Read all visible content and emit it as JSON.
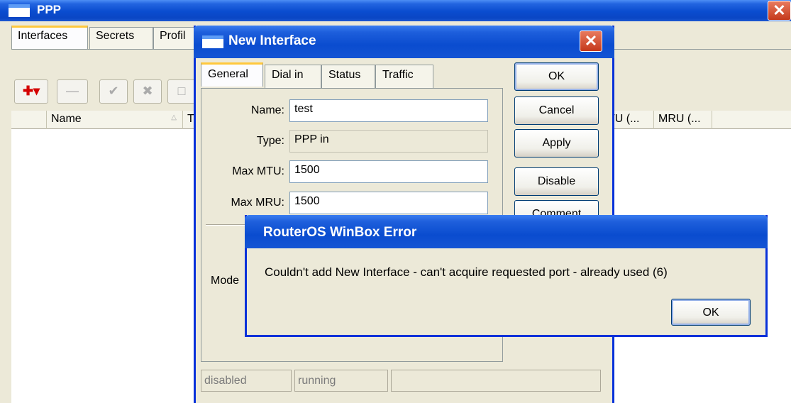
{
  "ppp_window": {
    "title": "PPP",
    "tabs": [
      "Interfaces",
      "Secrets",
      "Profil"
    ],
    "toolbar": {
      "add_symbol": "✚▾",
      "remove_symbol": "—",
      "enable_symbol": "✔",
      "disable_symbol": "✖",
      "comment_symbol": "□"
    },
    "columns": {
      "name": "Name",
      "sort_indicator": "△",
      "type_partial": "T",
      "mtu": "TU (...",
      "mru": "MRU (..."
    }
  },
  "new_interface": {
    "title": "New Interface",
    "tabs": [
      "General",
      "Dial in",
      "Status",
      "Traffic"
    ],
    "fields": {
      "name_label": "Name:",
      "name_value": "test",
      "type_label": "Type:",
      "type_value": "PPP in",
      "mtu_label": "Max MTU:",
      "mtu_value": "1500",
      "mru_label": "Max MRU:",
      "mru_value": "1500",
      "mode_label": "Mode"
    },
    "buttons": {
      "ok": "OK",
      "cancel": "Cancel",
      "apply": "Apply",
      "disable": "Disable",
      "comment": "Comment"
    },
    "status": {
      "state": "disabled",
      "running": "running"
    }
  },
  "error_dialog": {
    "title": "RouterOS WinBox Error",
    "message": "Couldn't add New Interface - can't acquire requested port - already used (6)",
    "ok": "OK"
  },
  "colors": {
    "titlebar_blue": "#0a4ccf",
    "window_bg": "#ece9d8",
    "close_red": "#c5391b",
    "tab_highlight": "#ffc83c"
  }
}
